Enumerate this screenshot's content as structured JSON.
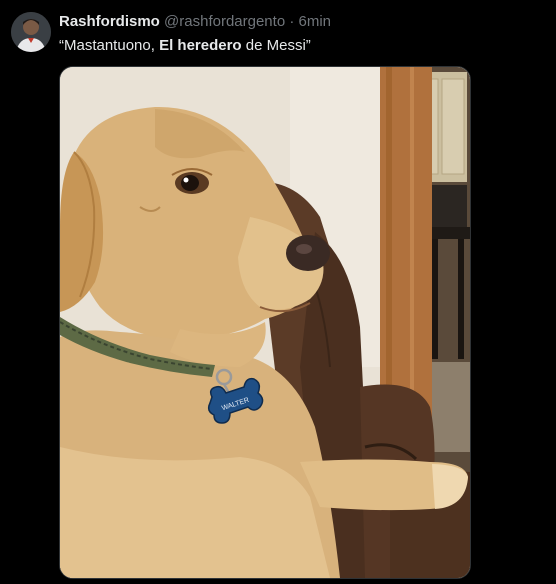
{
  "tweet": {
    "display_name": "Rashfordismo",
    "handle": "@rashfordargento",
    "separator": "·",
    "time": "6min",
    "text_prefix": "“Mastantuono, ",
    "text_bold": "El heredero",
    "text_suffix": " de Messi”"
  },
  "media": {
    "tag_text": "WALTER"
  },
  "colors": {
    "background": "#000000",
    "text": "#e7e9ea",
    "secondary_text": "#71767b"
  }
}
